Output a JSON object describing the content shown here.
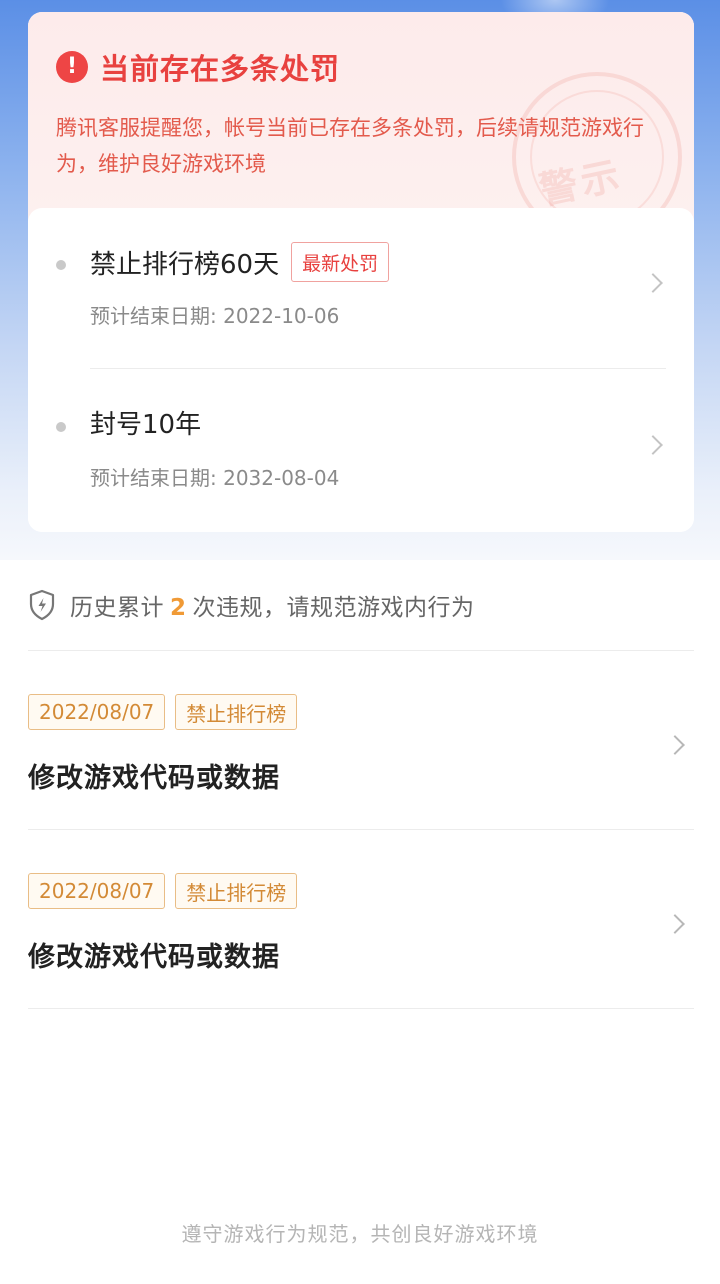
{
  "alert": {
    "icon": "exclamation-icon",
    "title": "当前存在多条处罚",
    "description": "腾讯客服提醒您，帐号当前已存在多条处罚，后续请规范游戏行为，维护良好游戏环境",
    "stamp_text": "警示",
    "color": "#e8413f"
  },
  "penalties": [
    {
      "title": "禁止排行榜60天",
      "tag": "最新处罚",
      "end_date_label": "预计结束日期: 2022-10-06"
    },
    {
      "title": "封号10年",
      "tag": "",
      "end_date_label": "预计结束日期: 2032-08-04"
    }
  ],
  "history": {
    "icon": "shield-icon",
    "prefix": "历史累计",
    "count": "2",
    "suffix": "次违规，请规范游戏内行为",
    "count_color": "#f09a36"
  },
  "violations": [
    {
      "date": "2022/08/07",
      "type": "禁止排行榜",
      "reason": "修改游戏代码或数据"
    },
    {
      "date": "2022/08/07",
      "type": "禁止排行榜",
      "reason": "修改游戏代码或数据"
    }
  ],
  "footer": {
    "text": "遵守游戏行为规范，共创良好游戏环境"
  }
}
